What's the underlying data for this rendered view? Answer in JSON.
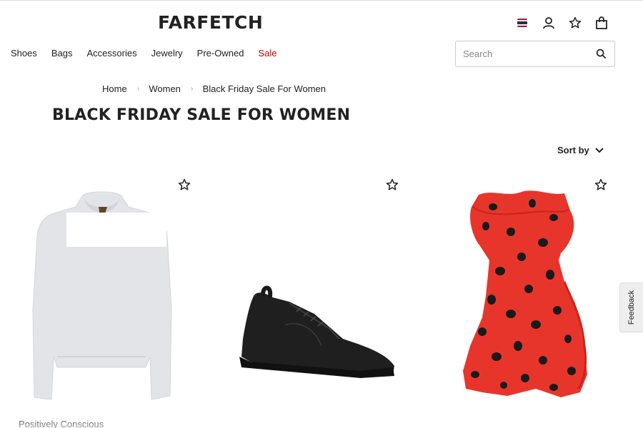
{
  "header": {
    "logo": "FARFETCH",
    "icons": [
      "flag-icon",
      "account-icon",
      "wishlist-icon",
      "bag-icon"
    ]
  },
  "nav": {
    "items": [
      {
        "label": "Shoes"
      },
      {
        "label": "Bags"
      },
      {
        "label": "Accessories"
      },
      {
        "label": "Jewelry"
      },
      {
        "label": "Pre-Owned"
      },
      {
        "label": "Sale"
      }
    ]
  },
  "search": {
    "placeholder": "Search",
    "value": ""
  },
  "breadcrumb": {
    "items": [
      "Home",
      "Women",
      "Black Friday Sale For Women"
    ],
    "separator": "›"
  },
  "page": {
    "title": "BLACK FRIDAY SALE FOR WOMEN",
    "sort_label": "Sort by"
  },
  "products": [
    {
      "image": "grey-hoodie",
      "wishlisted": false,
      "label": "Positively Conscious"
    },
    {
      "image": "black-sneaker",
      "wishlisted": false
    },
    {
      "image": "red-polka-dot-dress",
      "wishlisted": false
    }
  ],
  "feedback": {
    "label": "Feedback"
  },
  "colors": {
    "sale": "#cc0000",
    "text": "#222222",
    "dress": "#e8352b",
    "hoodie": "#e2e4e8"
  }
}
